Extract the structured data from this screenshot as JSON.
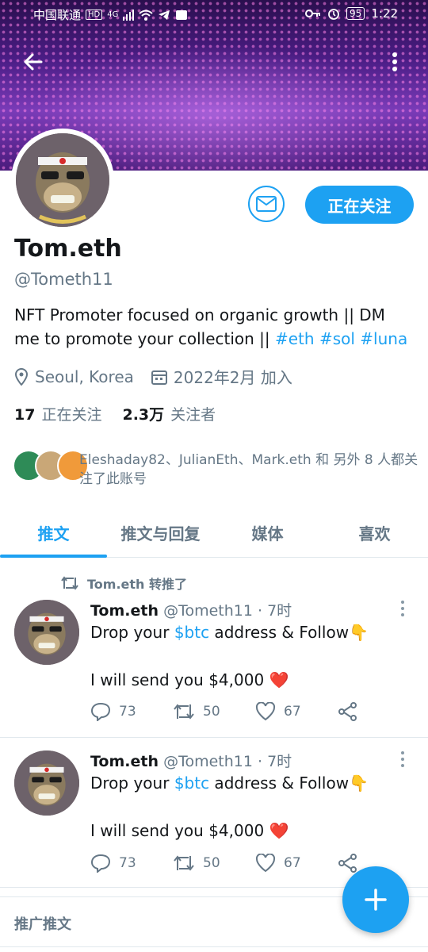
{
  "status_bar": {
    "carrier": "中国联通",
    "network": "4G",
    "battery": "95",
    "time": "1:22"
  },
  "profile": {
    "name": "Tom.eth",
    "handle": "@Tometh11",
    "bio_text": "NFT Promoter focused on organic growth || DM me to promote your collection ||",
    "bio_hashtags": [
      "#eth",
      "#sol",
      "#luna"
    ],
    "location": "Seoul, Korea",
    "joined": "2022年2月 加入",
    "following_count": "17",
    "following_label": "正在关注",
    "followers_count": "2.3万",
    "followers_label": "关注者",
    "follow_button": "正在关注",
    "known_followers_text": "Eleshaday82、JulianEth、Mark.eth 和 另外 8 人都关注了此账号"
  },
  "tabs": [
    {
      "label": "推文",
      "active": true
    },
    {
      "label": "推文与回复",
      "active": false
    },
    {
      "label": "媒体",
      "active": false
    },
    {
      "label": "喜欢",
      "active": false
    }
  ],
  "tweets": [
    {
      "retweet_label": "Tom.eth 转推了",
      "name": "Tom.eth",
      "handle": "@Tometh11",
      "time": "· 7时",
      "line1_pre": "Drop your ",
      "line1_link": "$btc",
      "line1_post": " address & Follow👇",
      "line2": "I will send you $4,000 ❤️",
      "replies": "73",
      "retweets": "50",
      "likes": "67"
    },
    {
      "name": "Tom.eth",
      "handle": "@Tometh11",
      "time": "· 7时",
      "line1_pre": "Drop your ",
      "line1_link": "$btc",
      "line1_post": " address & Follow👇",
      "line2": "I will send you $4,000 ❤️",
      "replies": "73",
      "retweets": "50",
      "likes": "67"
    }
  ],
  "promoted_label": "推广推文",
  "colors": {
    "accent": "#1da1f2",
    "muted": "#657786",
    "text": "#14171a",
    "heart": "#e0245e"
  }
}
